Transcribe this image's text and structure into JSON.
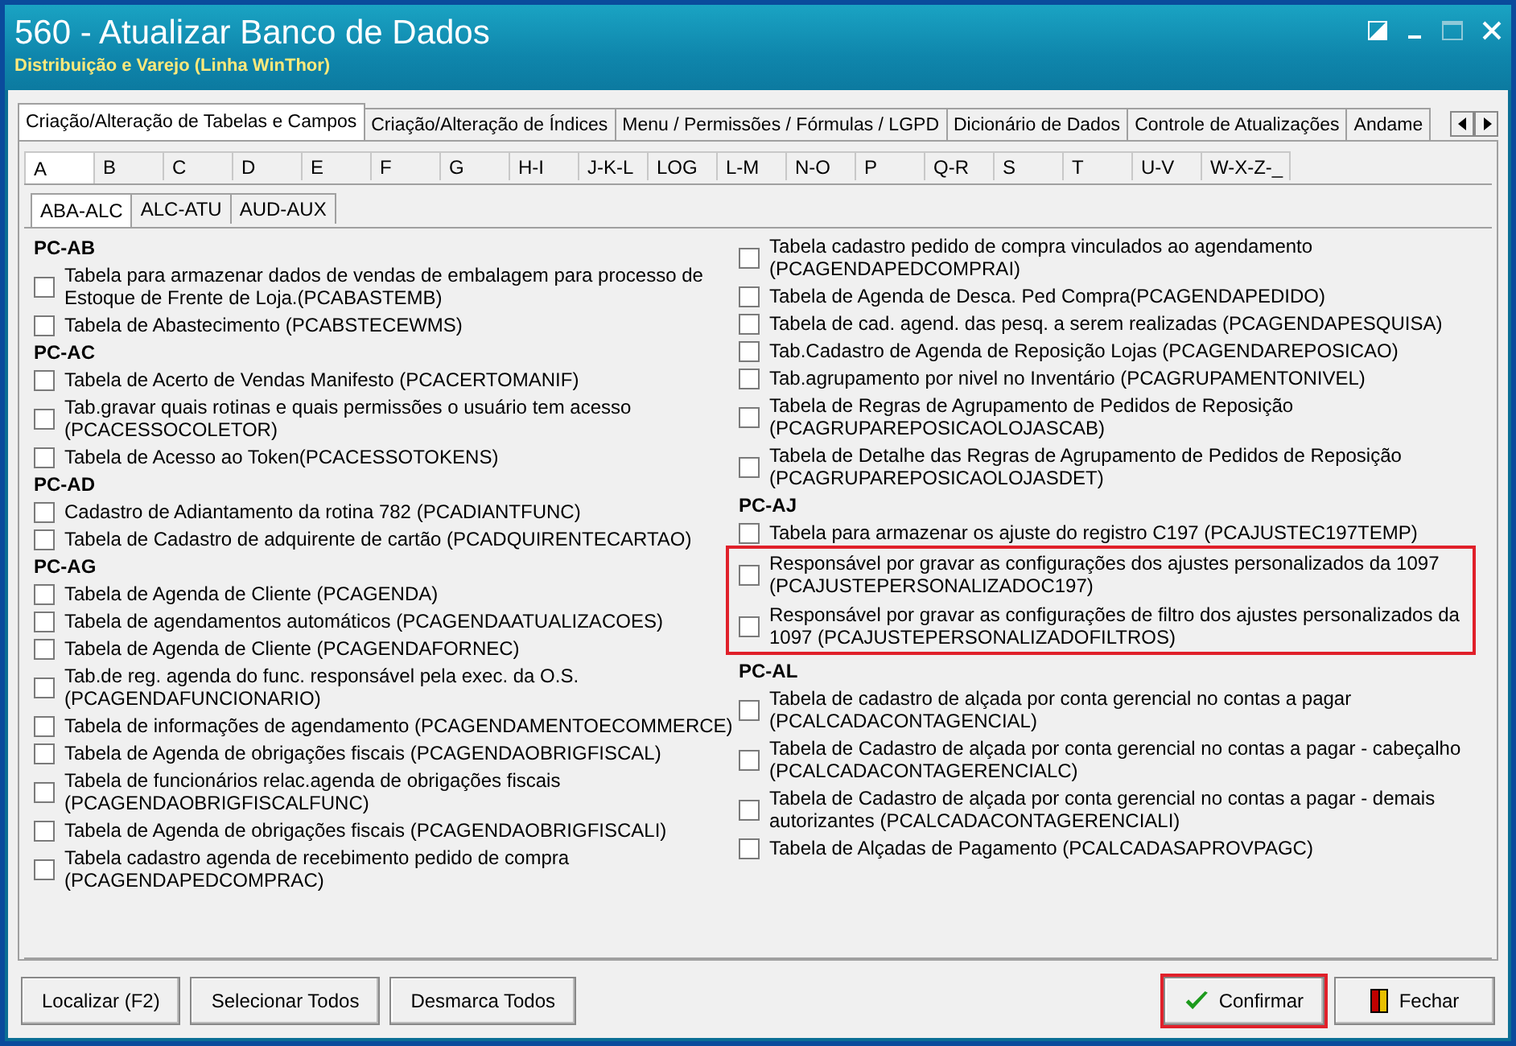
{
  "window": {
    "title": "560 - Atualizar Banco de Dados",
    "subtitle": "Distribuição e Varejo (Linha WinThor)"
  },
  "tabs": [
    {
      "label": "Criação/Alteração de Tabelas e Campos",
      "selected": true
    },
    {
      "label": "Criação/Alteração de Índices",
      "selected": false
    },
    {
      "label": "Menu / Permissões / Fórmulas / LGPD",
      "selected": false
    },
    {
      "label": "Dicionário de Dados",
      "selected": false
    },
    {
      "label": "Controle de Atualizações",
      "selected": false
    },
    {
      "label": "Andame",
      "selected": false
    }
  ],
  "letter_tabs": [
    {
      "label": "A",
      "selected": true
    },
    {
      "label": "B",
      "selected": false
    },
    {
      "label": "C",
      "selected": false
    },
    {
      "label": "D",
      "selected": false
    },
    {
      "label": "E",
      "selected": false
    },
    {
      "label": "F",
      "selected": false
    },
    {
      "label": "G",
      "selected": false
    },
    {
      "label": "H-I",
      "selected": false
    },
    {
      "label": "J-K-L",
      "selected": false
    },
    {
      "label": "LOG",
      "selected": false
    },
    {
      "label": "L-M",
      "selected": false
    },
    {
      "label": "N-O",
      "selected": false
    },
    {
      "label": "P",
      "selected": false
    },
    {
      "label": "Q-R",
      "selected": false
    },
    {
      "label": "S",
      "selected": false
    },
    {
      "label": "T",
      "selected": false
    },
    {
      "label": "U-V",
      "selected": false
    },
    {
      "label": "W-X-Z-_",
      "selected": false
    }
  ],
  "sub_tabs": [
    {
      "label": "ABA-ALC",
      "selected": true
    },
    {
      "label": "ALC-ATU",
      "selected": false
    },
    {
      "label": "AUD-AUX",
      "selected": false
    }
  ],
  "columns": [
    [
      {
        "kind": "heading",
        "label": "PC-AB"
      },
      {
        "kind": "item",
        "label": "Tabela para armazenar dados de vendas de embalagem para processo de Estoque de Frente de Loja.(PCABASTEMB)",
        "checked": false
      },
      {
        "kind": "item",
        "label": "Tabela de Abastecimento (PCABSTECEWMS)",
        "checked": false
      },
      {
        "kind": "heading",
        "label": "PC-AC"
      },
      {
        "kind": "item",
        "label": "Tabela de Acerto de Vendas Manifesto (PCACERTOMANIF)",
        "checked": false
      },
      {
        "kind": "item",
        "label": "Tab.gravar quais rotinas e quais permissões o usuário tem acesso (PCACESSOCOLETOR)",
        "checked": false
      },
      {
        "kind": "item",
        "label": "Tabela de Acesso ao Token(PCACESSOTOKENS)",
        "checked": false
      },
      {
        "kind": "heading",
        "label": "PC-AD"
      },
      {
        "kind": "item",
        "label": "Cadastro de Adiantamento da rotina 782 (PCADIANTFUNC)",
        "checked": false
      },
      {
        "kind": "item",
        "label": "Tabela de Cadastro de adquirente de cartão (PCADQUIRENTECARTAO)",
        "checked": false
      },
      {
        "kind": "heading",
        "label": "PC-AG"
      },
      {
        "kind": "item",
        "label": "Tabela  de Agenda de Cliente (PCAGENDA)",
        "checked": false
      },
      {
        "kind": "item",
        "label": "Tabela de agendamentos automáticos (PCAGENDAATUALIZACOES)",
        "checked": false
      },
      {
        "kind": "item",
        "label": "Tabela  de Agenda de Cliente (PCAGENDAFORNEC)",
        "checked": false
      },
      {
        "kind": "item",
        "label": "Tab.de reg. agenda do func. responsável pela exec. da O.S. (PCAGENDAFUNCIONARIO)",
        "checked": false
      },
      {
        "kind": "item",
        "label": "Tabela de informações de agendamento (PCAGENDAMENTOECOMMERCE)",
        "checked": false
      },
      {
        "kind": "item",
        "label": "Tabela de Agenda de obrigações fiscais (PCAGENDAOBRIGFISCAL)",
        "checked": false
      },
      {
        "kind": "item",
        "label": "Tabela de funcionários relac.agenda de obrigações fiscais (PCAGENDAOBRIGFISCALFUNC)",
        "checked": false
      },
      {
        "kind": "item",
        "label": "Tabela de Agenda de obrigações fiscais (PCAGENDAOBRIGFISCALI)",
        "checked": false
      },
      {
        "kind": "item",
        "label": "Tabela cadastro agenda de recebimento pedido de compra (PCAGENDAPEDCOMPRAC)",
        "checked": false
      }
    ],
    [
      {
        "kind": "item",
        "label": "Tabela cadastro pedido de compra vinculados ao agendamento (PCAGENDAPEDCOMPRAI)",
        "checked": false
      },
      {
        "kind": "item",
        "label": "Tabela  de Agenda de Desca. Ped Compra(PCAGENDAPEDIDO)",
        "checked": false
      },
      {
        "kind": "item",
        "label": "Tabela de cad. agend. das pesq. a serem realizadas (PCAGENDAPESQUISA)",
        "checked": false
      },
      {
        "kind": "item",
        "label": "Tab.Cadastro de Agenda de Reposição Lojas (PCAGENDAREPOSICAO)",
        "checked": false
      },
      {
        "kind": "item",
        "label": "Tab.agrupamento por nivel no Inventário (PCAGRUPAMENTONIVEL)",
        "checked": false
      },
      {
        "kind": "item",
        "label": "Tabela de Regras de Agrupamento de Pedidos de Reposição (PCAGRUPAREPOSICAOLOJASCAB)",
        "checked": false
      },
      {
        "kind": "item",
        "label": "Tabela de Detalhe das Regras de Agrupamento de Pedidos de Reposição (PCAGRUPAREPOSICAOLOJASDET)",
        "checked": false
      },
      {
        "kind": "heading",
        "label": "PC-AJ"
      },
      {
        "kind": "item",
        "label": "Tabela para armazenar os ajuste do registro C197 (PCAJUSTEC197TEMP)",
        "checked": false
      },
      {
        "kind": "highlight",
        "items": [
          {
            "label": "Responsável por gravar as configurações dos ajustes personalizados da 1097 (PCAJUSTEPERSONALIZADOC197)",
            "checked": false
          },
          {
            "label": "Responsável por gravar as configurações de filtro dos ajustes personalizados da 1097 (PCAJUSTEPERSONALIZADOFILTROS)",
            "checked": false
          }
        ]
      },
      {
        "kind": "heading",
        "label": "PC-AL"
      },
      {
        "kind": "item",
        "label": "Tabela de cadastro de alçada por conta gerencial no contas a pagar (PCALCADACONTAGENCIAL)",
        "checked": false
      },
      {
        "kind": "item",
        "label": "Tabela de Cadastro de alçada por conta gerencial no contas a pagar - cabeçalho (PCALCADACONTAGERENCIALC)",
        "checked": false
      },
      {
        "kind": "item",
        "label": "Tabela de Cadastro de alçada por conta gerencial no contas a pagar - demais autorizantes (PCALCADACONTAGERENCIALI)",
        "checked": false
      },
      {
        "kind": "item",
        "label": "Tabela de Alçadas de Pagamento (PCALCADASAPROVPAGC)",
        "checked": false
      }
    ]
  ],
  "left_buttons": [
    {
      "label": "Localizar (F2)"
    },
    {
      "label": "Selecionar Todos"
    },
    {
      "label": "Desmarca Todos"
    }
  ],
  "right_buttons": [
    {
      "label": "Confirmar",
      "kind": "confirm",
      "highlighted": true
    },
    {
      "label": "Fechar",
      "kind": "close",
      "highlighted": false
    }
  ]
}
